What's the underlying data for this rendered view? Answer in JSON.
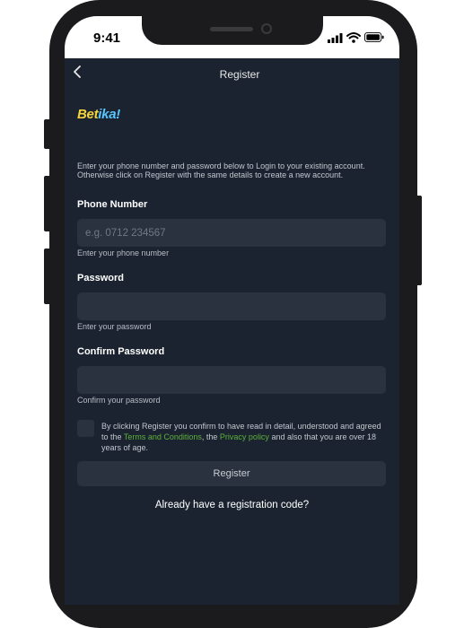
{
  "status_bar": {
    "time": "9:41"
  },
  "header": {
    "title": "Register"
  },
  "logo": {
    "part1": "Bet",
    "part2": "ika!"
  },
  "intro_text": "Enter your phone number and password below to Login to your existing account. Otherwise click on Register with the same details to create a new account.",
  "form": {
    "phone": {
      "label": "Phone Number",
      "placeholder": "e.g. 0712 234567",
      "value": "",
      "hint": "Enter your phone number"
    },
    "password": {
      "label": "Password",
      "placeholder": "",
      "value": "",
      "hint": "Enter your password"
    },
    "confirm_password": {
      "label": "Confirm Password",
      "placeholder": "",
      "value": "",
      "hint": "Confirm your password"
    }
  },
  "consent": {
    "checked": false,
    "text_before": "By clicking Register you confirm to have read in detail, understood and agreed to the ",
    "terms_link": "Terms and Conditions",
    "text_middle": ", the ",
    "privacy_link": "Privacy policy",
    "text_after": " and also that you are over 18 years of age."
  },
  "register_button": "Register",
  "registration_code_link": "Already have a registration code?",
  "colors": {
    "background": "#1b2330",
    "input": "#29323e",
    "link_green": "#5cb13a",
    "logo_yellow": "#f3d43a",
    "logo_blue": "#58c7ff"
  }
}
